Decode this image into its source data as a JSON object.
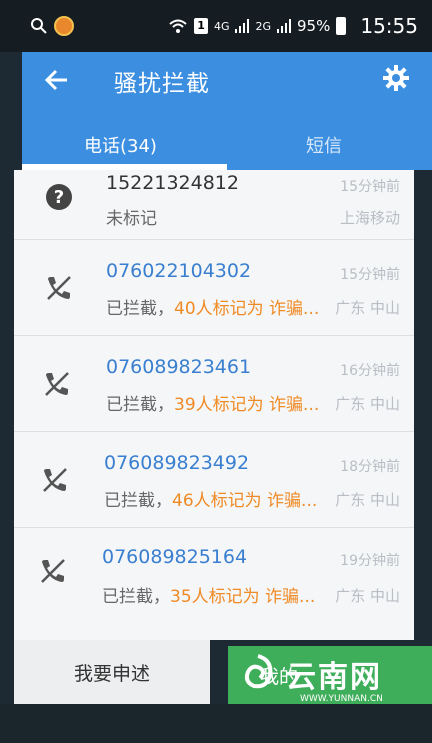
{
  "status_bar": {
    "sim": "1",
    "network_4g": "4G",
    "network_2g": "2G",
    "battery": "95%",
    "time": "15:55"
  },
  "header": {
    "title": "骚扰拦截",
    "tabs": [
      {
        "label": "电话(34)",
        "active": true
      },
      {
        "label": "短信",
        "active": false
      }
    ]
  },
  "calls": [
    {
      "number": "15221324812",
      "time": "15分钟前",
      "status": "未标记",
      "marked": "",
      "tag": "",
      "location": "上海移动",
      "icon": "unknown-caller-icon"
    },
    {
      "number": "076022104302",
      "time": "15分钟前",
      "status": "已拦截，",
      "marked": "40人标记为",
      "tag": "诈骗...",
      "location": "广东 中山",
      "icon": "blocked-call-icon"
    },
    {
      "number": "076089823461",
      "time": "16分钟前",
      "status": "已拦截，",
      "marked": "39人标记为",
      "tag": "诈骗...",
      "location": "广东 中山",
      "icon": "blocked-call-icon"
    },
    {
      "number": "076089823492",
      "time": "18分钟前",
      "status": "已拦截，",
      "marked": "46人标记为",
      "tag": "诈骗...",
      "location": "广东 中山",
      "icon": "blocked-call-icon"
    },
    {
      "number": "076089825164",
      "time": "19分钟前",
      "status": "已拦截，",
      "marked": "35人标记为",
      "tag": "诈骗...",
      "location": "广东 中山",
      "icon": "blocked-call-icon"
    }
  ],
  "bottom": {
    "appeal_label": "我要申述",
    "green_label": "我的"
  },
  "watermark": {
    "text": "云南网",
    "url": "WWW.YUNNAN.CN"
  },
  "colors": {
    "header_blue": "#3b8ee0",
    "fraud_orange": "#f08a24",
    "number_blue": "#3a7fcf",
    "button_green": "#3fae5a"
  }
}
